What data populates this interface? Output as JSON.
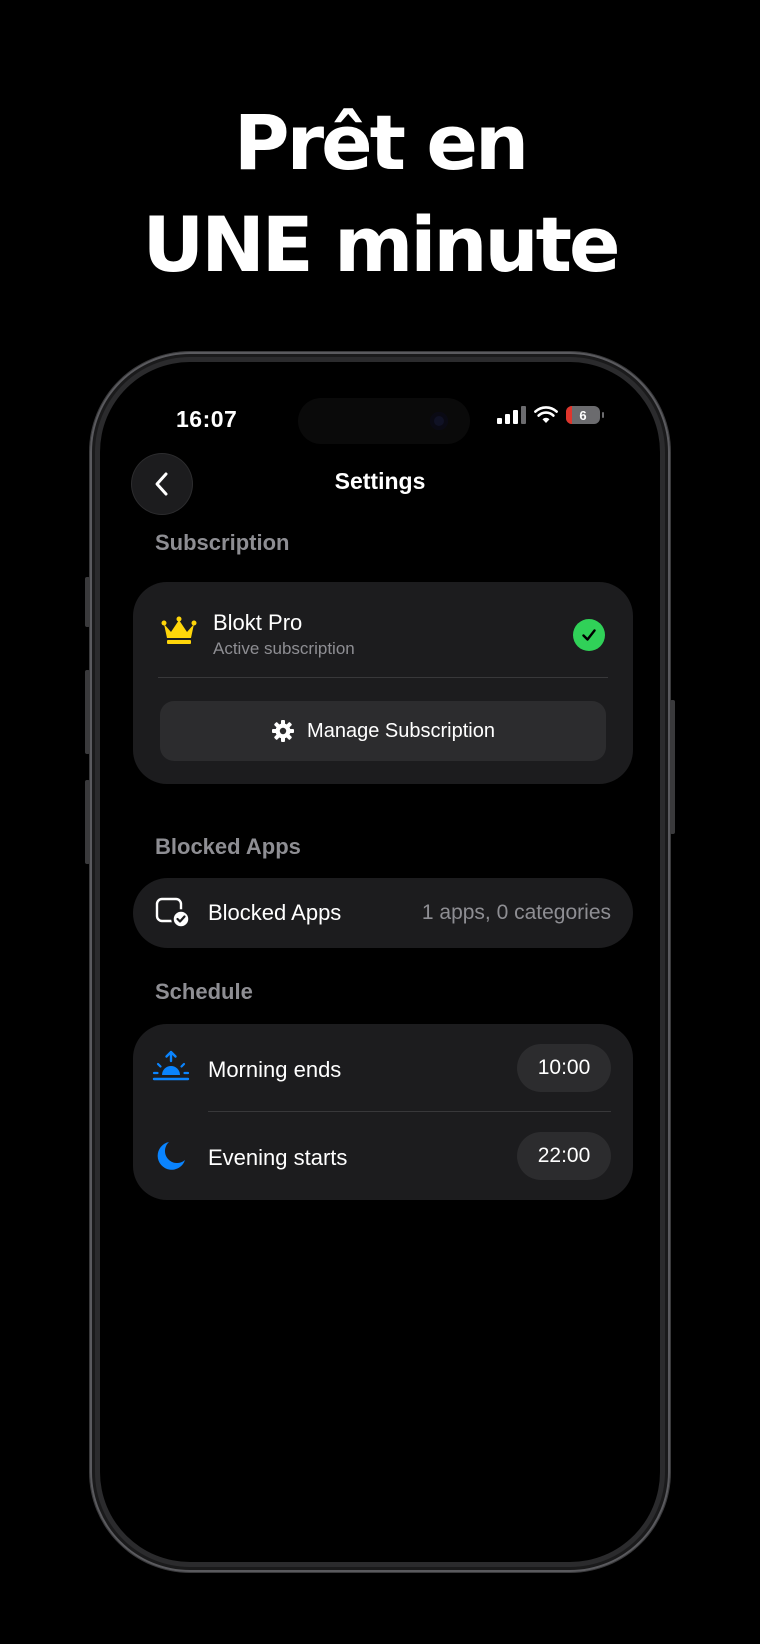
{
  "headline": {
    "line1": "Prêt en",
    "line2": "UNE minute"
  },
  "status_bar": {
    "time": "16:07",
    "battery": "6"
  },
  "nav": {
    "title": "Settings",
    "back_icon": "chevron-left-icon"
  },
  "subscription": {
    "section_label": "Subscription",
    "plan_name": "Blokt Pro",
    "plan_status": "Active subscription",
    "plan_icon": "crown-icon",
    "status_icon": "checkmark-circle-icon",
    "manage_label": "Manage Subscription",
    "manage_icon": "gear-icon"
  },
  "blocked_apps": {
    "section_label": "Blocked Apps",
    "row_label": "Blocked Apps",
    "row_value": "1 apps, 0 categories",
    "icon": "app-shield-check-icon"
  },
  "schedule": {
    "section_label": "Schedule",
    "items": [
      {
        "label": "Morning ends",
        "time": "10:00",
        "icon": "sunrise-icon"
      },
      {
        "label": "Evening starts",
        "time": "22:00",
        "icon": "moon-icon"
      }
    ]
  },
  "colors": {
    "background": "#000000",
    "card": "#1c1c1e",
    "pill": "#2c2c2e",
    "secondary_text": "#8e8e93",
    "accent_blue": "#0a84ff",
    "success_green": "#30d158",
    "crown_gold": "#ffd60a"
  }
}
